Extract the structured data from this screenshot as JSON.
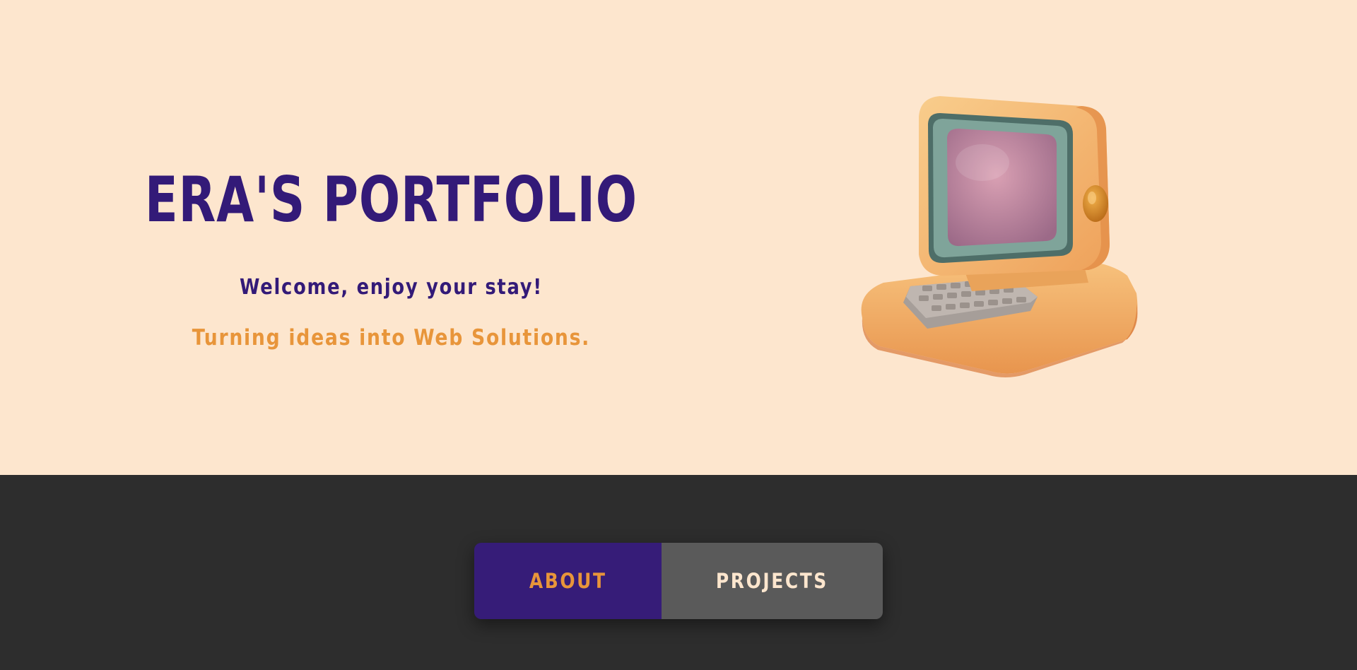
{
  "hero": {
    "title": "ERA'S PORTFOLIO",
    "welcome": "Welcome, enjoy your stay!",
    "tagline": "Turning ideas into Web Solutions.",
    "illustration_icon": "retro-computer-icon"
  },
  "nav": {
    "about_label": "ABOUT",
    "projects_label": "PROJECTS"
  },
  "colors": {
    "hero_background": "#fde6ce",
    "primary_purple": "#331a78",
    "accent_orange": "#e8953a",
    "footer_background": "#2d2d2d",
    "nav_inactive": "#5a5a5a"
  }
}
